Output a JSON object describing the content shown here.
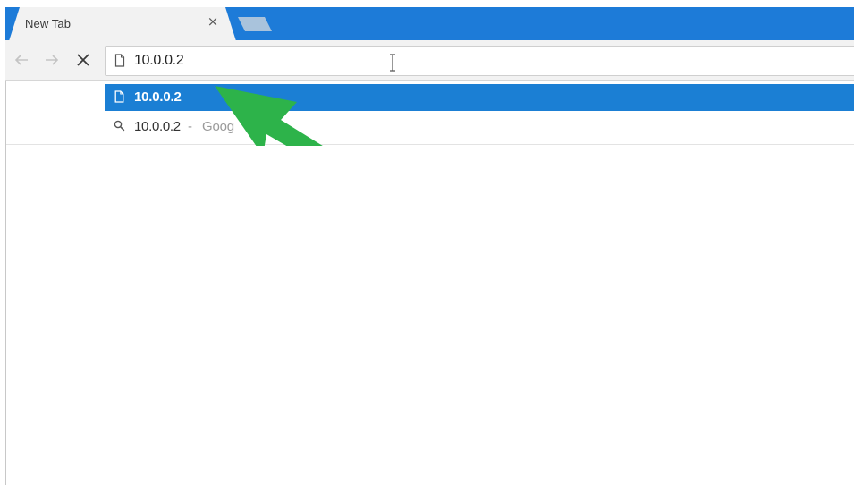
{
  "tab": {
    "title": "New Tab",
    "close_glyph": "×"
  },
  "toolbar": {
    "back_icon": "arrow-left-icon",
    "forward_icon": "arrow-right-icon",
    "stop_icon": "close-icon"
  },
  "omnibox": {
    "value": "10.0.0.2",
    "icon": "page-icon"
  },
  "suggestions": [
    {
      "icon": "page-icon",
      "text": "10.0.0.2",
      "selected": true
    },
    {
      "icon": "search-icon",
      "text": "10.0.0.2",
      "separator": "-",
      "provider": "Goog",
      "selected": false
    }
  ],
  "annotation": {
    "icon": "green-arrow-icon",
    "color": "#2db34a"
  },
  "colors": {
    "tabstrip": "#1d7bd8",
    "selection": "#1b7fd4",
    "toolbar": "#f2f2f2"
  }
}
